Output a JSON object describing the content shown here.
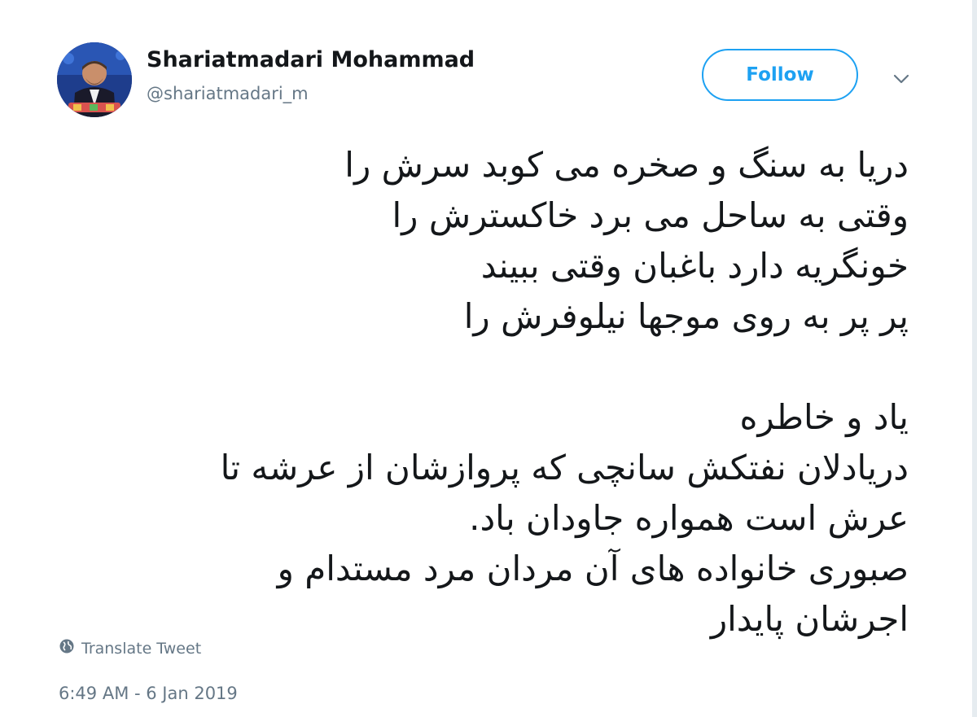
{
  "user": {
    "name": "Shariatmadari Mohammad",
    "handle": "@shariatmadari_m"
  },
  "follow_label": "Follow",
  "tweet": {
    "lines": [
      "دریا به سنگ و صخره می کوبد سرش را",
      "وقتی به ساحل می برد خاکسترش را",
      "خونگریه دارد باغبان وقتی ببیند",
      "پر پر به روی موجها نیلوفرش را",
      "",
      "یاد و خاطره",
      "دریادلان نفتکش سانچی که پروازشان از عرشه  تا",
      "عرش است همواره جاودان باد.",
      "صبوری خانواده های آن مردان مرد مستدام و",
      "اجرشان پایدار"
    ]
  },
  "translate_label": "Translate Tweet",
  "timestamp": "6:49 AM - 6 Jan 2019",
  "colors": {
    "accent": "#1da1f2",
    "secondary_text": "#657786",
    "primary_text": "#14171a"
  },
  "icons": {
    "caret": "chevron-down-icon",
    "translate": "globe-icon"
  }
}
